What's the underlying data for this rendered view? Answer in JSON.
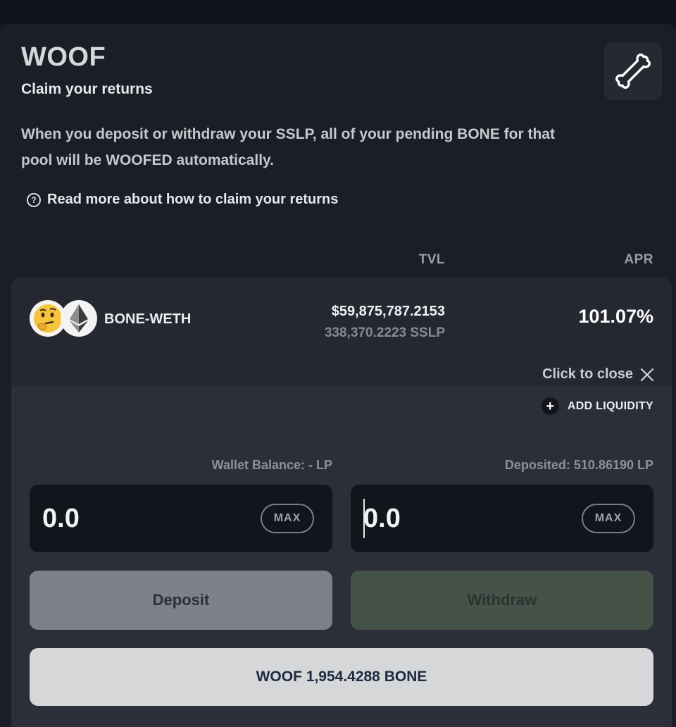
{
  "header": {
    "title": "WOOF",
    "subtitle": "Claim your returns",
    "description": "When you deposit or withdraw your SSLP, all of your pending BONE for that pool will be WOOFED automatically.",
    "read_more": "Read more about how to claim your returns",
    "bone_icon": "bone-icon"
  },
  "columns": {
    "tvl": "TVL",
    "apr": "APR"
  },
  "pool": {
    "token_a_icon": "thinking-face-icon",
    "token_b_icon": "ethereum-icon",
    "pair": "BONE-WETH",
    "tvl_usd": "$59,875,787.2153",
    "tvl_lp": "338,370.2223 SSLP",
    "apr": "101.07%",
    "close_label": "Click to close",
    "add_liquidity": "ADD LIQUIDITY",
    "wallet_balance": "Wallet Balance: - LP",
    "deposited": "Deposited: 510.86190 LP",
    "deposit_value": "0.0",
    "withdraw_value": "0.0",
    "max_label": "MAX",
    "deposit_button": "Deposit",
    "withdraw_button": "Withdraw",
    "woof_button": "WOOF 1,954.4288 BONE"
  },
  "colors": {
    "background": "#14171e",
    "card": "#1b1e26",
    "pool_header": "#252831",
    "pool_body": "#2c2f39",
    "input": "#13151c",
    "deposit_button": "#7f8189",
    "withdraw_button": "#455248",
    "woof_button": "#d6d7d9"
  }
}
